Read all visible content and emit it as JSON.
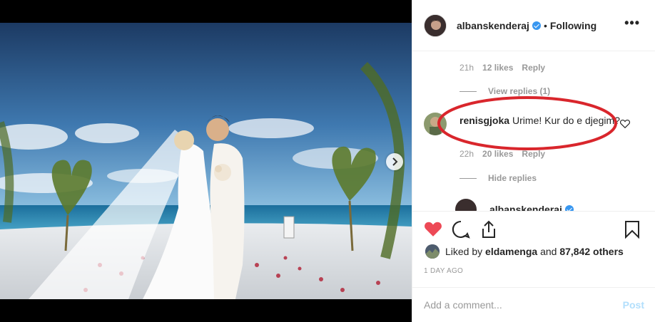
{
  "post": {
    "author": "albanskenderaj",
    "follow_status": "Following",
    "header_dot": "•",
    "more_label": "•••"
  },
  "comments": {
    "first_meta": {
      "time": "21h",
      "likes": "12 likes",
      "reply": "Reply"
    },
    "view_replies": "View replies (1)",
    "main_comment": {
      "username": "renisgjoka",
      "text": "Urime! Kur do e djegim?",
      "time": "22h",
      "likes": "20 likes",
      "reply": "Reply"
    },
    "hide_replies": "Hide replies",
    "reply_author": "albanskenderaj"
  },
  "actions": {
    "liked_by_prefix": "Liked by ",
    "liked_by_user": "eldamenga",
    "liked_by_middle": " and ",
    "liked_by_count": "87,842 others",
    "time_ago": "1 DAY AGO"
  },
  "comment_box": {
    "placeholder": "Add a comment...",
    "post_label": "Post"
  },
  "icons": {
    "like": "heart-filled-icon",
    "comment": "comment-icon",
    "share": "share-icon",
    "save": "bookmark-icon",
    "next": "chevron-right-icon"
  },
  "colors": {
    "like_red": "#ed4956",
    "verified_blue": "#3897f0",
    "annotation_red": "#d9262c",
    "post_disabled": "#b2dffc"
  }
}
